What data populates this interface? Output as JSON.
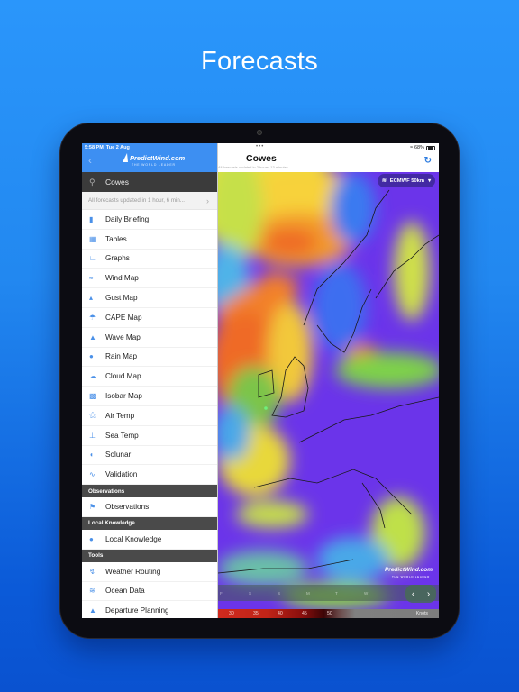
{
  "promo": {
    "title": "Forecasts"
  },
  "status_bar": {
    "time": "5:58 PM",
    "date": "Tue 2 Aug",
    "battery": "68%",
    "dots": "•••"
  },
  "sidebar": {
    "logo": "PredictWind.com",
    "logo_tagline": "THE WORLD LEADER",
    "location": "Cowes",
    "updated_text": "All forecasts updated in 1 hour, 6 min...",
    "items": [
      {
        "label": "Daily Briefing",
        "icon": "document-icon"
      },
      {
        "label": "Tables",
        "icon": "table-icon"
      },
      {
        "label": "Graphs",
        "icon": "graph-icon"
      },
      {
        "label": "Wind Map",
        "icon": "wind-icon"
      },
      {
        "label": "Gust Map",
        "icon": "gust-icon"
      },
      {
        "label": "CAPE Map",
        "icon": "storm-icon"
      },
      {
        "label": "Wave Map",
        "icon": "wave-icon"
      },
      {
        "label": "Rain Map",
        "icon": "raindrop-icon"
      },
      {
        "label": "Cloud Map",
        "icon": "cloud-icon"
      },
      {
        "label": "Isobar Map",
        "icon": "isobar-icon"
      },
      {
        "label": "Air Temp",
        "icon": "thermometer-icon"
      },
      {
        "label": "Sea Temp",
        "icon": "sea-temp-icon"
      },
      {
        "label": "Solunar",
        "icon": "moon-icon"
      },
      {
        "label": "Validation",
        "icon": "validation-icon"
      }
    ],
    "sections": [
      {
        "header": "Observations",
        "items": [
          {
            "label": "Observations",
            "icon": "flags-icon"
          }
        ]
      },
      {
        "header": "Local Knowledge",
        "items": [
          {
            "label": "Local Knowledge",
            "icon": "info-pin-icon"
          }
        ]
      },
      {
        "header": "Tools",
        "items": [
          {
            "label": "Weather Routing",
            "icon": "route-icon"
          },
          {
            "label": "Ocean Data",
            "icon": "ocean-icon"
          },
          {
            "label": "Departure Planning",
            "icon": "departure-icon"
          }
        ]
      }
    ]
  },
  "main": {
    "title": "Cowes",
    "subtitle": "All forecasts updated in 2 hours, 13 minutes",
    "model_selector": "ECMWF 50km",
    "map_logo": "PredictWind.com",
    "map_logo_tagline": "THE WORLD LEADER",
    "timeline_days": [
      "F",
      "S",
      "S",
      "M",
      "T",
      "W"
    ],
    "legend": {
      "ticks": [
        "30",
        "35",
        "40",
        "45",
        "50"
      ],
      "units": "Knots"
    }
  }
}
